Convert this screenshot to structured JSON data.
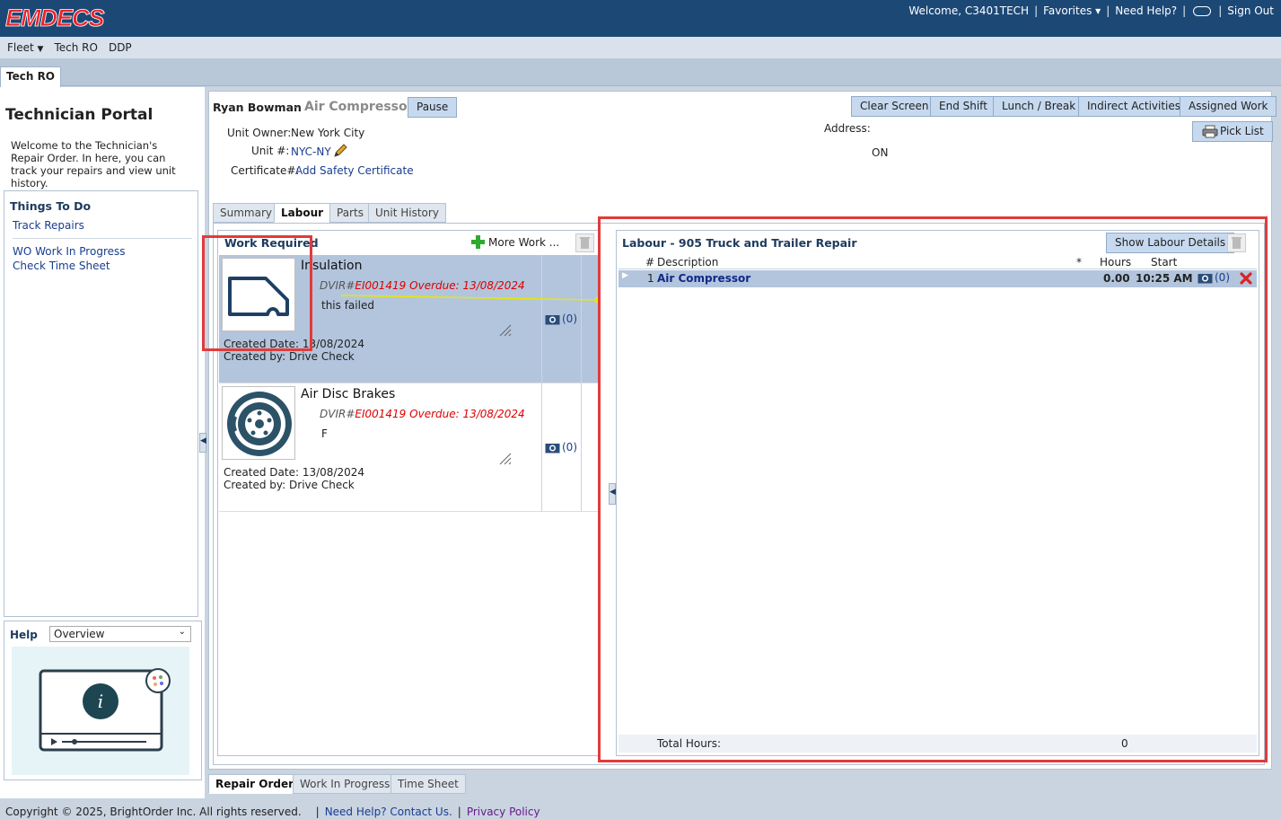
{
  "brand": {
    "logo_text": "EMDECS"
  },
  "topnav": {
    "welcome": "Welcome, C3401TECH",
    "favorites": "Favorites",
    "need_help": "Need Help?",
    "sign_out": "Sign Out"
  },
  "menubar": {
    "items": [
      "Fleet",
      "Tech RO",
      "DDP"
    ]
  },
  "window_tab": "Tech RO",
  "sidebar": {
    "title": "Technician Portal",
    "welcome": "Welcome to the Technician's Repair Order. In here, you can track your repairs and view unit history.",
    "todo_header": "Things To Do",
    "links": [
      "Track Repairs",
      "WO Work In Progress",
      "Check Time Sheet"
    ],
    "help_label": "Help",
    "help_select": "Overview"
  },
  "header": {
    "tech_name": "Ryan Bowman",
    "dash": "-",
    "job": "Air Compressor",
    "pause": "Pause",
    "unit_owner_label": "Unit Owner:",
    "unit_owner": "New York City",
    "unit_label": "Unit #:",
    "unit": "NYC-NY",
    "cert_label": "Certificate#:",
    "cert_link": "Add Safety Certificate",
    "address_label": "Address:",
    "address_value": "ON",
    "actions": [
      "Clear Screen",
      "End Shift",
      "Lunch / Break",
      "Indirect Activities",
      "Assigned Work"
    ],
    "pick_list": "Pick List"
  },
  "tabs": [
    "Summary",
    "Labour",
    "Parts",
    "Unit History"
  ],
  "active_tab": "Labour",
  "work_required": {
    "title": "Work Required",
    "more_work": "More Work ...",
    "items": [
      {
        "title": "Insulation",
        "dvir_prefix": "DVIR#",
        "dvir": "EI001419",
        "overdue": "Overdue: 13/08/2024",
        "note": "this failed",
        "created_label": "Created Date:",
        "created": "13/08/2024",
        "by_label": "Created by:",
        "by": "Drive Check",
        "photos": "(0)",
        "icon": "door-panel-icon"
      },
      {
        "title": "Air Disc Brakes",
        "dvir_prefix": "DVIR#",
        "dvir": "EI001419",
        "overdue": "Overdue: 13/08/2024",
        "note": "F",
        "created_label": "Created Date:",
        "created": "13/08/2024",
        "by_label": "Created by:",
        "by": "Drive Check",
        "photos": "(0)",
        "icon": "brake-disc-icon"
      }
    ]
  },
  "labour": {
    "title": "Labour - 905 Truck and Trailer Repair",
    "show_details": "Show Labour Details",
    "columns": {
      "num": "#",
      "desc": "Description",
      "star": "*",
      "hours": "Hours",
      "start": "Start"
    },
    "rows": [
      {
        "num": "1",
        "desc": "Air Compressor",
        "hours": "0.00",
        "start": "10:25 AM",
        "photos": "(0)"
      }
    ],
    "total_label": "Total Hours:",
    "total_value": "0"
  },
  "bottom_tabs": [
    "Repair Order",
    "Work In Progress",
    "Time Sheet"
  ],
  "active_bottom_tab": "Repair Order",
  "footer": {
    "copyright": "Copyright © 2025, BrightOrder Inc. All rights reserved.",
    "sep": "|",
    "help": "Need Help? Contact Us.",
    "privacy": "Privacy Policy"
  },
  "colors": {
    "header_bg": "#1c4876",
    "logo_red": "#e8232a",
    "accent_blue": "#1a3d8f",
    "selected_row": "#b3c5dc",
    "overdue_red": "#dd0000",
    "highlight_box": "#e23b3b"
  }
}
